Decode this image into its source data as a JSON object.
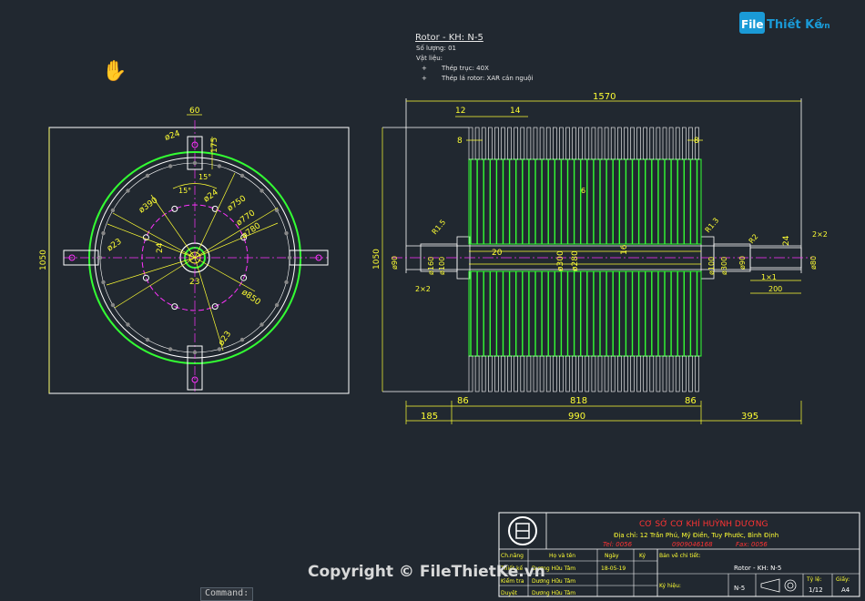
{
  "watermark_logo": {
    "prefix": "File",
    "name": "Thiết Kế",
    "suffix": ".vn"
  },
  "copyright": "Copyright © FileThietKe.vn",
  "command_label": "Command:",
  "notes": {
    "title": "Rotor - KH: N-5",
    "qty": "Số lượng: 01",
    "material_label": "Vật liệu:",
    "items": [
      "Thép trục: 40X",
      "Thép lá rotor: XAR cán nguội"
    ],
    "bullet": "+"
  },
  "front_view": {
    "dims": {
      "top_width": "60",
      "hole_dia": "ø24",
      "slot_len": "175",
      "angle1": "15°",
      "angle2": "15°",
      "d390": "ø390",
      "d24b": "ø24",
      "d750": "ø750",
      "d770": "ø770",
      "d780": "ø780",
      "d23a": "ø23",
      "d24c": "24",
      "d23b": "23",
      "d850": "ø850",
      "d23c": "ø23",
      "height": "1050"
    }
  },
  "side_view": {
    "dims": {
      "total": "1570",
      "d12": "12",
      "d14": "14",
      "d8l": "8",
      "d8r": "8",
      "d6": "6",
      "r15": "R1.5",
      "r13": "R1.3",
      "r2": "R2",
      "d24": "24",
      "d2x2r": "2×2",
      "d20": "20",
      "d16": "16",
      "d300": "ø300",
      "d280": "ø280",
      "d100l": "ø100",
      "d160": "ø160",
      "d100r": "ø100",
      "d300r": "ø300",
      "d90l": "ø90",
      "d90r": "ø90",
      "d80": "ø80",
      "height": "1050",
      "d2x2l": "2×2",
      "d1x1": "1×1",
      "d200": "200",
      "d86l": "86",
      "d818": "818",
      "d86r": "86",
      "d185": "185",
      "d990": "990",
      "d395": "395"
    }
  },
  "title_block": {
    "company": "CƠ SỞ CƠ KHÍ HUỲNH DƯƠNG",
    "address": "Địa chỉ: 12 Trần Phú, Mỹ Điền, Tuy Phước, Bình Định",
    "tel": "Tel: 0056",
    "phone": "0909046168",
    "fax": "Fax: 0056",
    "headers": [
      "Ch.năng",
      "Họ và tên",
      "Ngày",
      "Ký"
    ],
    "rows": [
      {
        "role": "Thiết kế",
        "name": "Dương Hữu Tâm",
        "date": "18-05-19"
      },
      {
        "role": "Kiểm tra",
        "name": "Dương Hữu Tâm",
        "date": ""
      },
      {
        "role": "Duyệt",
        "name": "Dương Hữu Tâm",
        "date": ""
      }
    ],
    "drawing_title_label": "Bản vẽ chi tiết:",
    "drawing_name": "Rotor - KH: N-5",
    "code_label": "Ký hiệu:",
    "code": "N-5",
    "scale_label": "Tỷ lệ:",
    "scale": "1/12",
    "size_label": "Giấy:",
    "size": "A4"
  },
  "colors": {
    "background": "#212830",
    "dimension": "#ffff33",
    "outline": "#ffffff",
    "rotor": "#33ff33",
    "center": "#ff33ff",
    "company": "#ff3333",
    "info": "#ffff33"
  }
}
